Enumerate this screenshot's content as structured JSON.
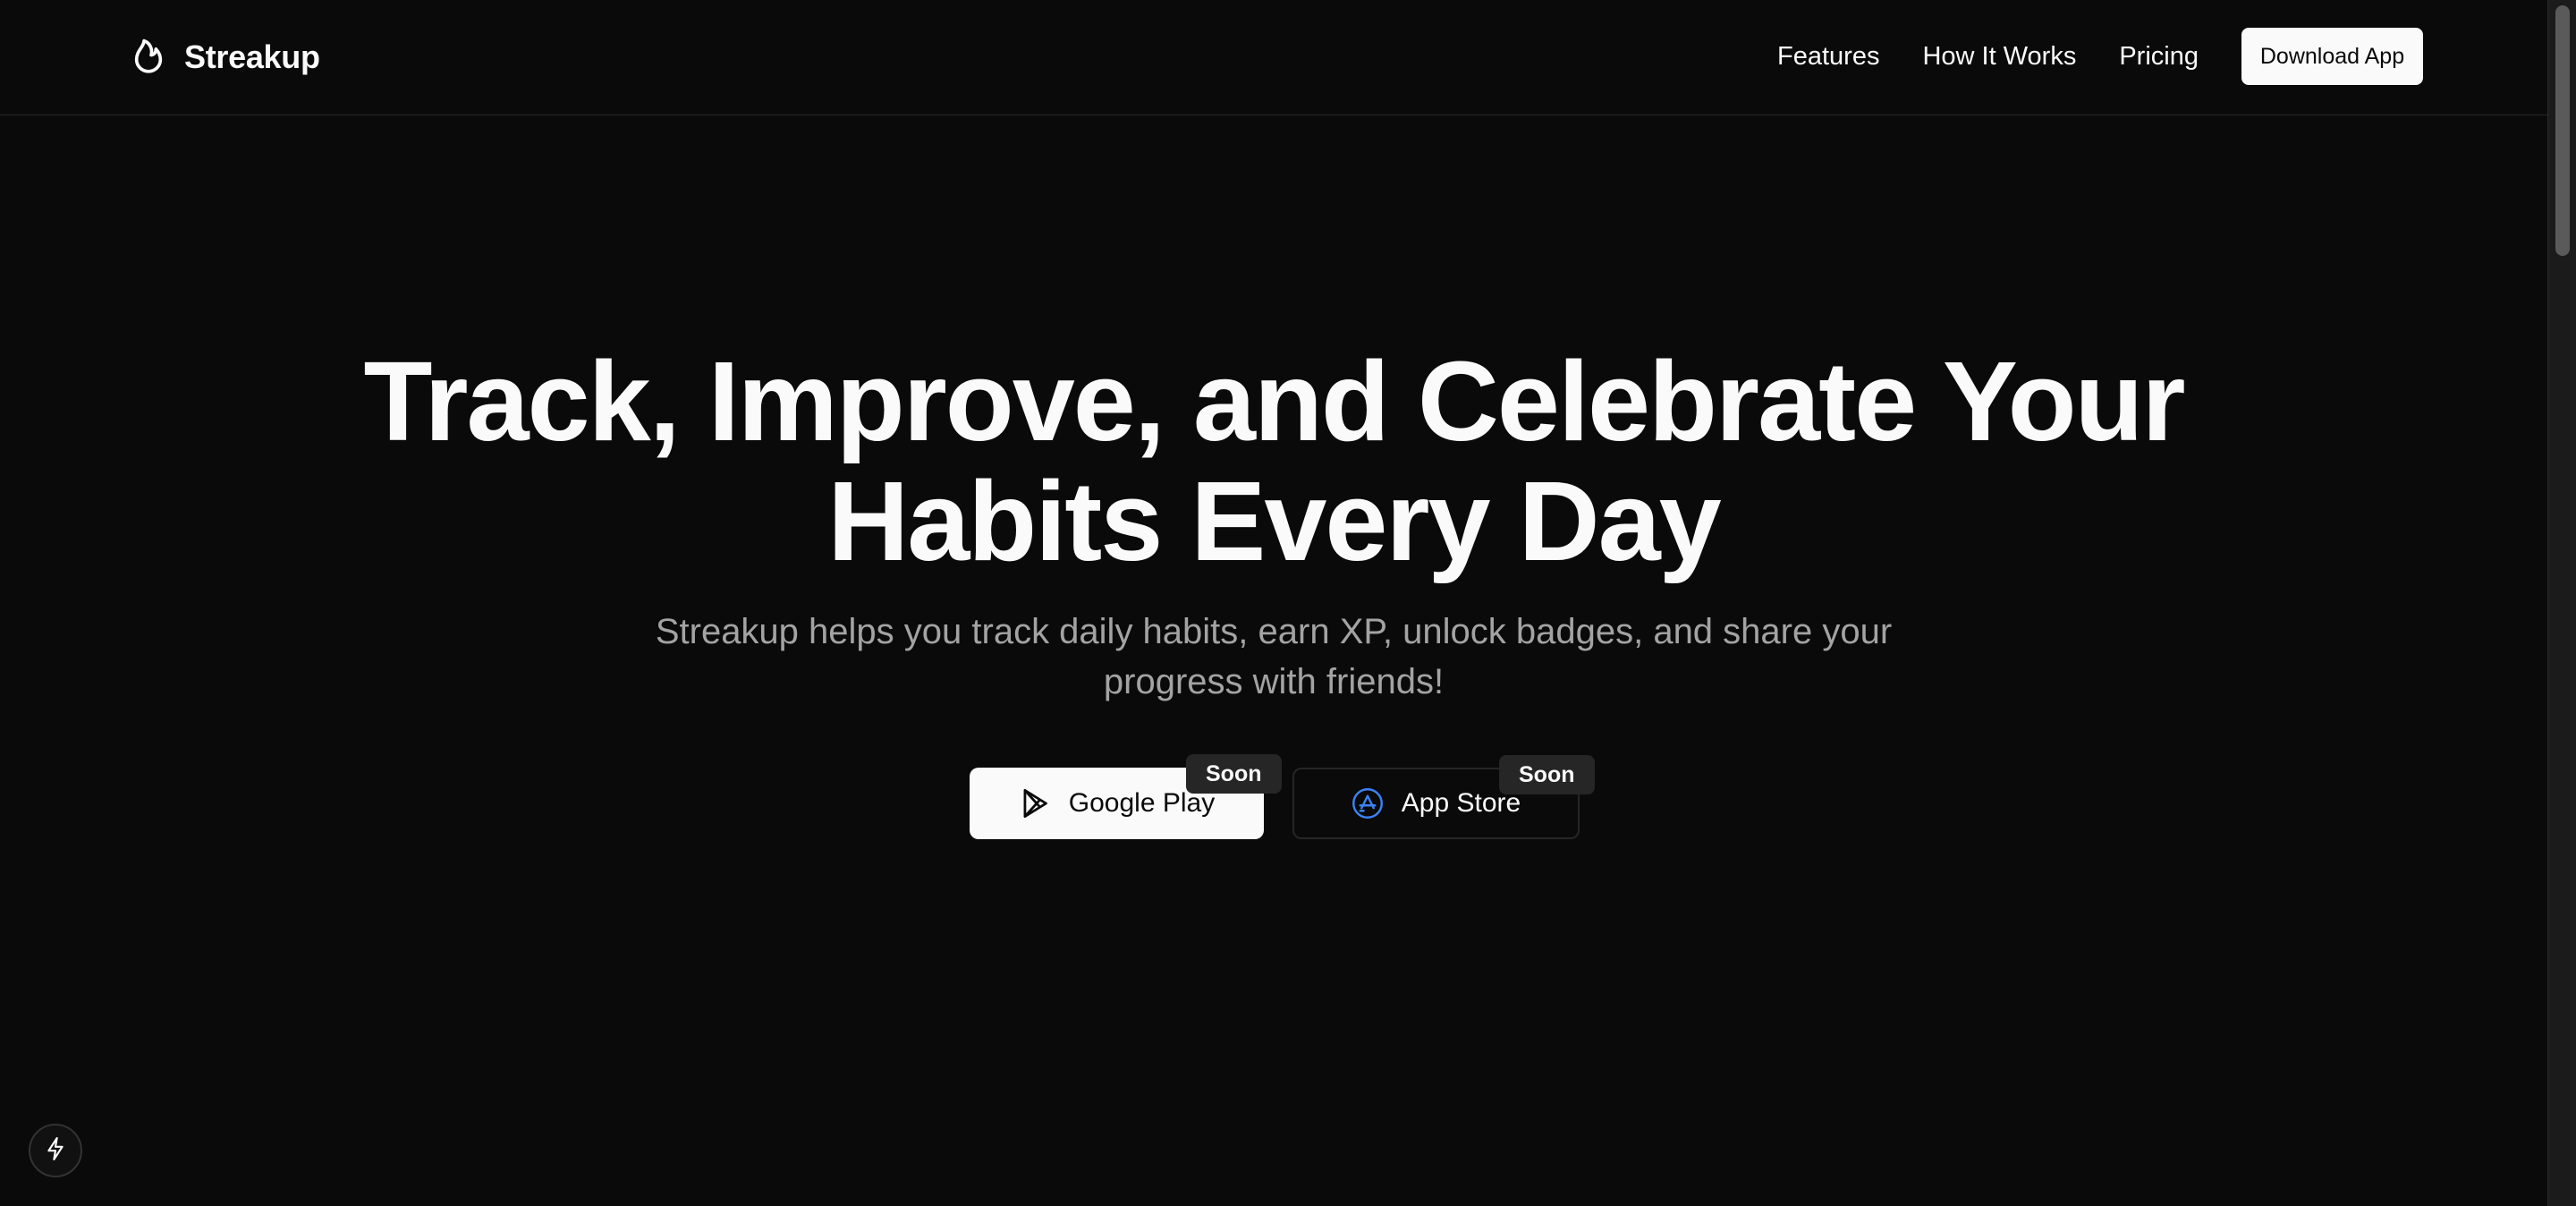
{
  "header": {
    "brand_name": "Streakup",
    "brand_icon": "flame-icon",
    "nav": [
      "Features",
      "How It Works",
      "Pricing"
    ],
    "cta_label": "Download App"
  },
  "hero": {
    "title_line1": "Track, Improve, and Celebrate Your",
    "title_line2": "Habits Every Day",
    "subtitle_line1": "Streakup helps you track daily habits, earn XP, unlock badges, and share your",
    "subtitle_line2": "progress with friends!"
  },
  "stores": {
    "google": {
      "label": "Google Play",
      "badge": "Soon",
      "icon": "google-play-icon"
    },
    "apple": {
      "label": "App Store",
      "badge": "Soon",
      "icon": "app-store-icon"
    }
  },
  "fab": {
    "icon": "lightning-icon"
  },
  "colors": {
    "background": "#0a0a0a",
    "foreground": "#fafafa",
    "muted": "#a3a3a3",
    "border": "#262626",
    "app_store_accent": "#3b82f6"
  }
}
